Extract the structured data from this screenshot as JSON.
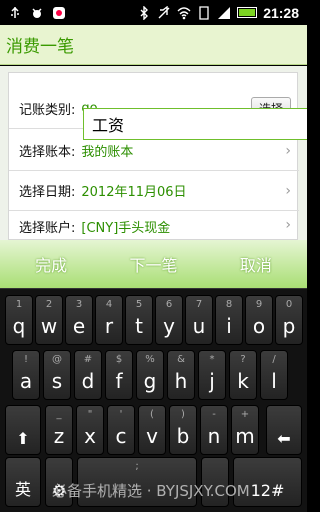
{
  "statusbar": {
    "left_icons": [
      "usb-icon",
      "debug-icon",
      "app-icon"
    ],
    "right_icons": [
      "bluetooth-icon",
      "mute-icon",
      "wifi-icon",
      "sd-icon",
      "signal-icon"
    ],
    "time": "21:28",
    "battery_level": 0.9
  },
  "title": "消费一笔",
  "form": {
    "category_label": "记账类别:",
    "category_value": "go",
    "choose_label": "选择",
    "account_book_label": "选择账本:",
    "account_book_value": "我的账本",
    "date_label": "选择日期:",
    "date_value": "2012年11月06日",
    "account_label": "选择账户:",
    "account_value": "[CNY]手头现金"
  },
  "suggestion": "工资",
  "actions": {
    "done": "完成",
    "next": "下一笔",
    "cancel": "取消"
  },
  "keyboard": {
    "row1": [
      {
        "main": "q",
        "alt": "1"
      },
      {
        "main": "w",
        "alt": "2"
      },
      {
        "main": "e",
        "alt": "3"
      },
      {
        "main": "r",
        "alt": "4"
      },
      {
        "main": "t",
        "alt": "5"
      },
      {
        "main": "y",
        "alt": "6"
      },
      {
        "main": "u",
        "alt": "7"
      },
      {
        "main": "i",
        "alt": "8"
      },
      {
        "main": "o",
        "alt": "9"
      },
      {
        "main": "p",
        "alt": "0"
      }
    ],
    "row2": [
      {
        "main": "a",
        "alt": "!"
      },
      {
        "main": "s",
        "alt": "@"
      },
      {
        "main": "d",
        "alt": "#"
      },
      {
        "main": "f",
        "alt": "$"
      },
      {
        "main": "g",
        "alt": "%"
      },
      {
        "main": "h",
        "alt": "&"
      },
      {
        "main": "j",
        "alt": "*"
      },
      {
        "main": "k",
        "alt": "?"
      },
      {
        "main": "l",
        "alt": "/"
      }
    ],
    "row3": [
      {
        "main": "z",
        "alt": "_"
      },
      {
        "main": "x",
        "alt": "\""
      },
      {
        "main": "c",
        "alt": "'"
      },
      {
        "main": "v",
        "alt": "("
      },
      {
        "main": "b",
        "alt": ")"
      },
      {
        "main": "n",
        "alt": "-"
      },
      {
        "main": "m",
        "alt": "+"
      }
    ],
    "shift": "⬆",
    "backspace": "⬅",
    "lang": "英",
    "settings": "⚙",
    "space_alt": ";",
    "num_switch": "12#"
  },
  "watermark": "必备手机精选 · BYJSJXY.COM"
}
